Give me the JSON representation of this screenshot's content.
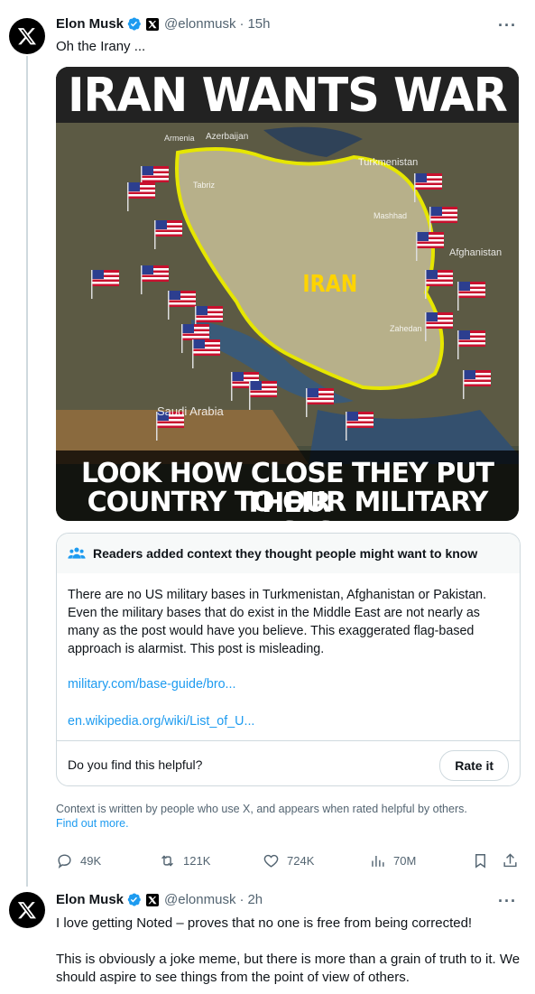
{
  "tweet1": {
    "author": "Elon Musk",
    "handle": "@elonmusk",
    "time": "15h",
    "text": "Oh the Irany ...",
    "more_icon": "ellipsis-icon",
    "media": {
      "headline": "IRAN WANTS WAR",
      "footer_line1": "LOOK HOW CLOSE THEY PUT THEIR",
      "footer_line2": "COUNTRY TO OUR MILITARY BASES",
      "map_center_label": "IRAN",
      "map_labels": [
        "Turkmenistan",
        "Afghanistan",
        "Saudi Arabia",
        "Armenia",
        "Azerbaijan",
        "Mashhad",
        "Tabriz",
        "Zahedan"
      ]
    },
    "note": {
      "header": "Readers added context they thought people might want to know",
      "body": "There are no US military bases in Turkmenistan, Afghanistan or Pakistan. Even the military bases that do exist in the Middle East are not nearly as many as the post would have you believe. This exaggerated flag-based approach is alarmist. This post is misleading.",
      "link1": "military.com/base-guide/bro...",
      "link2": "en.wikipedia.org/wiki/List_of_U...",
      "helpful_question": "Do you find this helpful?",
      "rate_button": "Rate it"
    },
    "context_text": "Context is written by people who use X, and appears when rated helpful by others.",
    "find_out_more": "Find out more.",
    "stats": {
      "replies": "49K",
      "reposts": "121K",
      "likes": "724K",
      "views": "70M"
    }
  },
  "tweet2": {
    "author": "Elon Musk",
    "handle": "@elonmusk",
    "time": "2h",
    "line1": "I love getting Noted – proves that no one is free from being corrected!",
    "line2": "This is obviously a joke meme, but there is more than a grain of truth to it. We should aspire to see things from the point of view of others."
  },
  "separator": "·",
  "colors": {
    "accent": "#1d9bf0",
    "secondary_text": "#536471",
    "border": "#cfd9de",
    "verified": "#1d9bf0",
    "map_border": "#e6e600"
  }
}
